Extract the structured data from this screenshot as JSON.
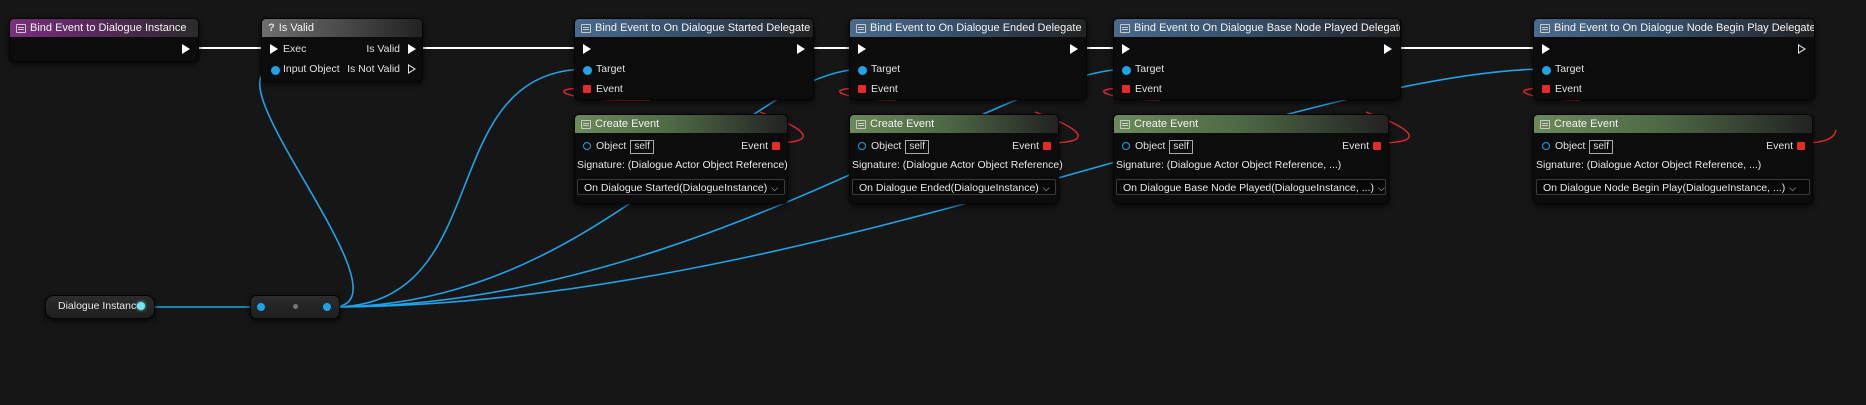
{
  "nodes": {
    "bind_instance": {
      "title": "Bind Event to Dialogue Instance"
    },
    "is_valid": {
      "title": "Is Valid",
      "title_icon": "?",
      "exec_label": "Exec",
      "input_label": "Input Object",
      "is_valid_label": "Is Valid",
      "not_valid_label": "Is Not Valid"
    },
    "bind_started": {
      "title": "Bind Event to On Dialogue Started Delegate",
      "target_label": "Target",
      "event_label": "Event"
    },
    "bind_ended": {
      "title": "Bind Event to On Dialogue Ended Delegate",
      "target_label": "Target",
      "event_label": "Event"
    },
    "bind_base_node": {
      "title": "Bind Event to On Dialogue Base Node Played Delegate",
      "target_label": "Target",
      "event_label": "Event"
    },
    "bind_begin_play": {
      "title": "Bind Event to On Dialogue Node Begin Play Delegate",
      "target_label": "Target",
      "event_label": "Event"
    },
    "create_event_started": {
      "title": "Create Event",
      "object_label": "Object",
      "self_label": "self",
      "event_label": "Event",
      "signature": "Signature: (Dialogue Actor Object Reference)",
      "selected": "On Dialogue Started(DialogueInstance)"
    },
    "create_event_ended": {
      "title": "Create Event",
      "object_label": "Object",
      "self_label": "self",
      "event_label": "Event",
      "signature": "Signature: (Dialogue Actor Object Reference)",
      "selected": "On Dialogue Ended(DialogueInstance)"
    },
    "create_event_base_node": {
      "title": "Create Event",
      "object_label": "Object",
      "self_label": "self",
      "event_label": "Event",
      "signature": "Signature: (Dialogue Actor Object Reference, ...)",
      "selected": "On Dialogue Base Node Played(DialogueInstance, ...)"
    },
    "create_event_begin_play": {
      "title": "Create Event",
      "object_label": "Object",
      "self_label": "self",
      "event_label": "Event",
      "signature": "Signature: (Dialogue Actor Object Reference, ...)",
      "selected": "On Dialogue Node Begin Play(DialogueInstance, ...)"
    },
    "dialogue_instance_var": {
      "label": "Dialogue Instance"
    }
  },
  "colors": {
    "background": "#161616",
    "exec_wire": "#ffffff",
    "object_wire": "#1fa3e8",
    "delegate_wire": "#e52a2a",
    "variable_pin": "#6fe6f5"
  },
  "icons": {
    "function": "function-icon",
    "dropdown": "chevron-down-icon"
  }
}
